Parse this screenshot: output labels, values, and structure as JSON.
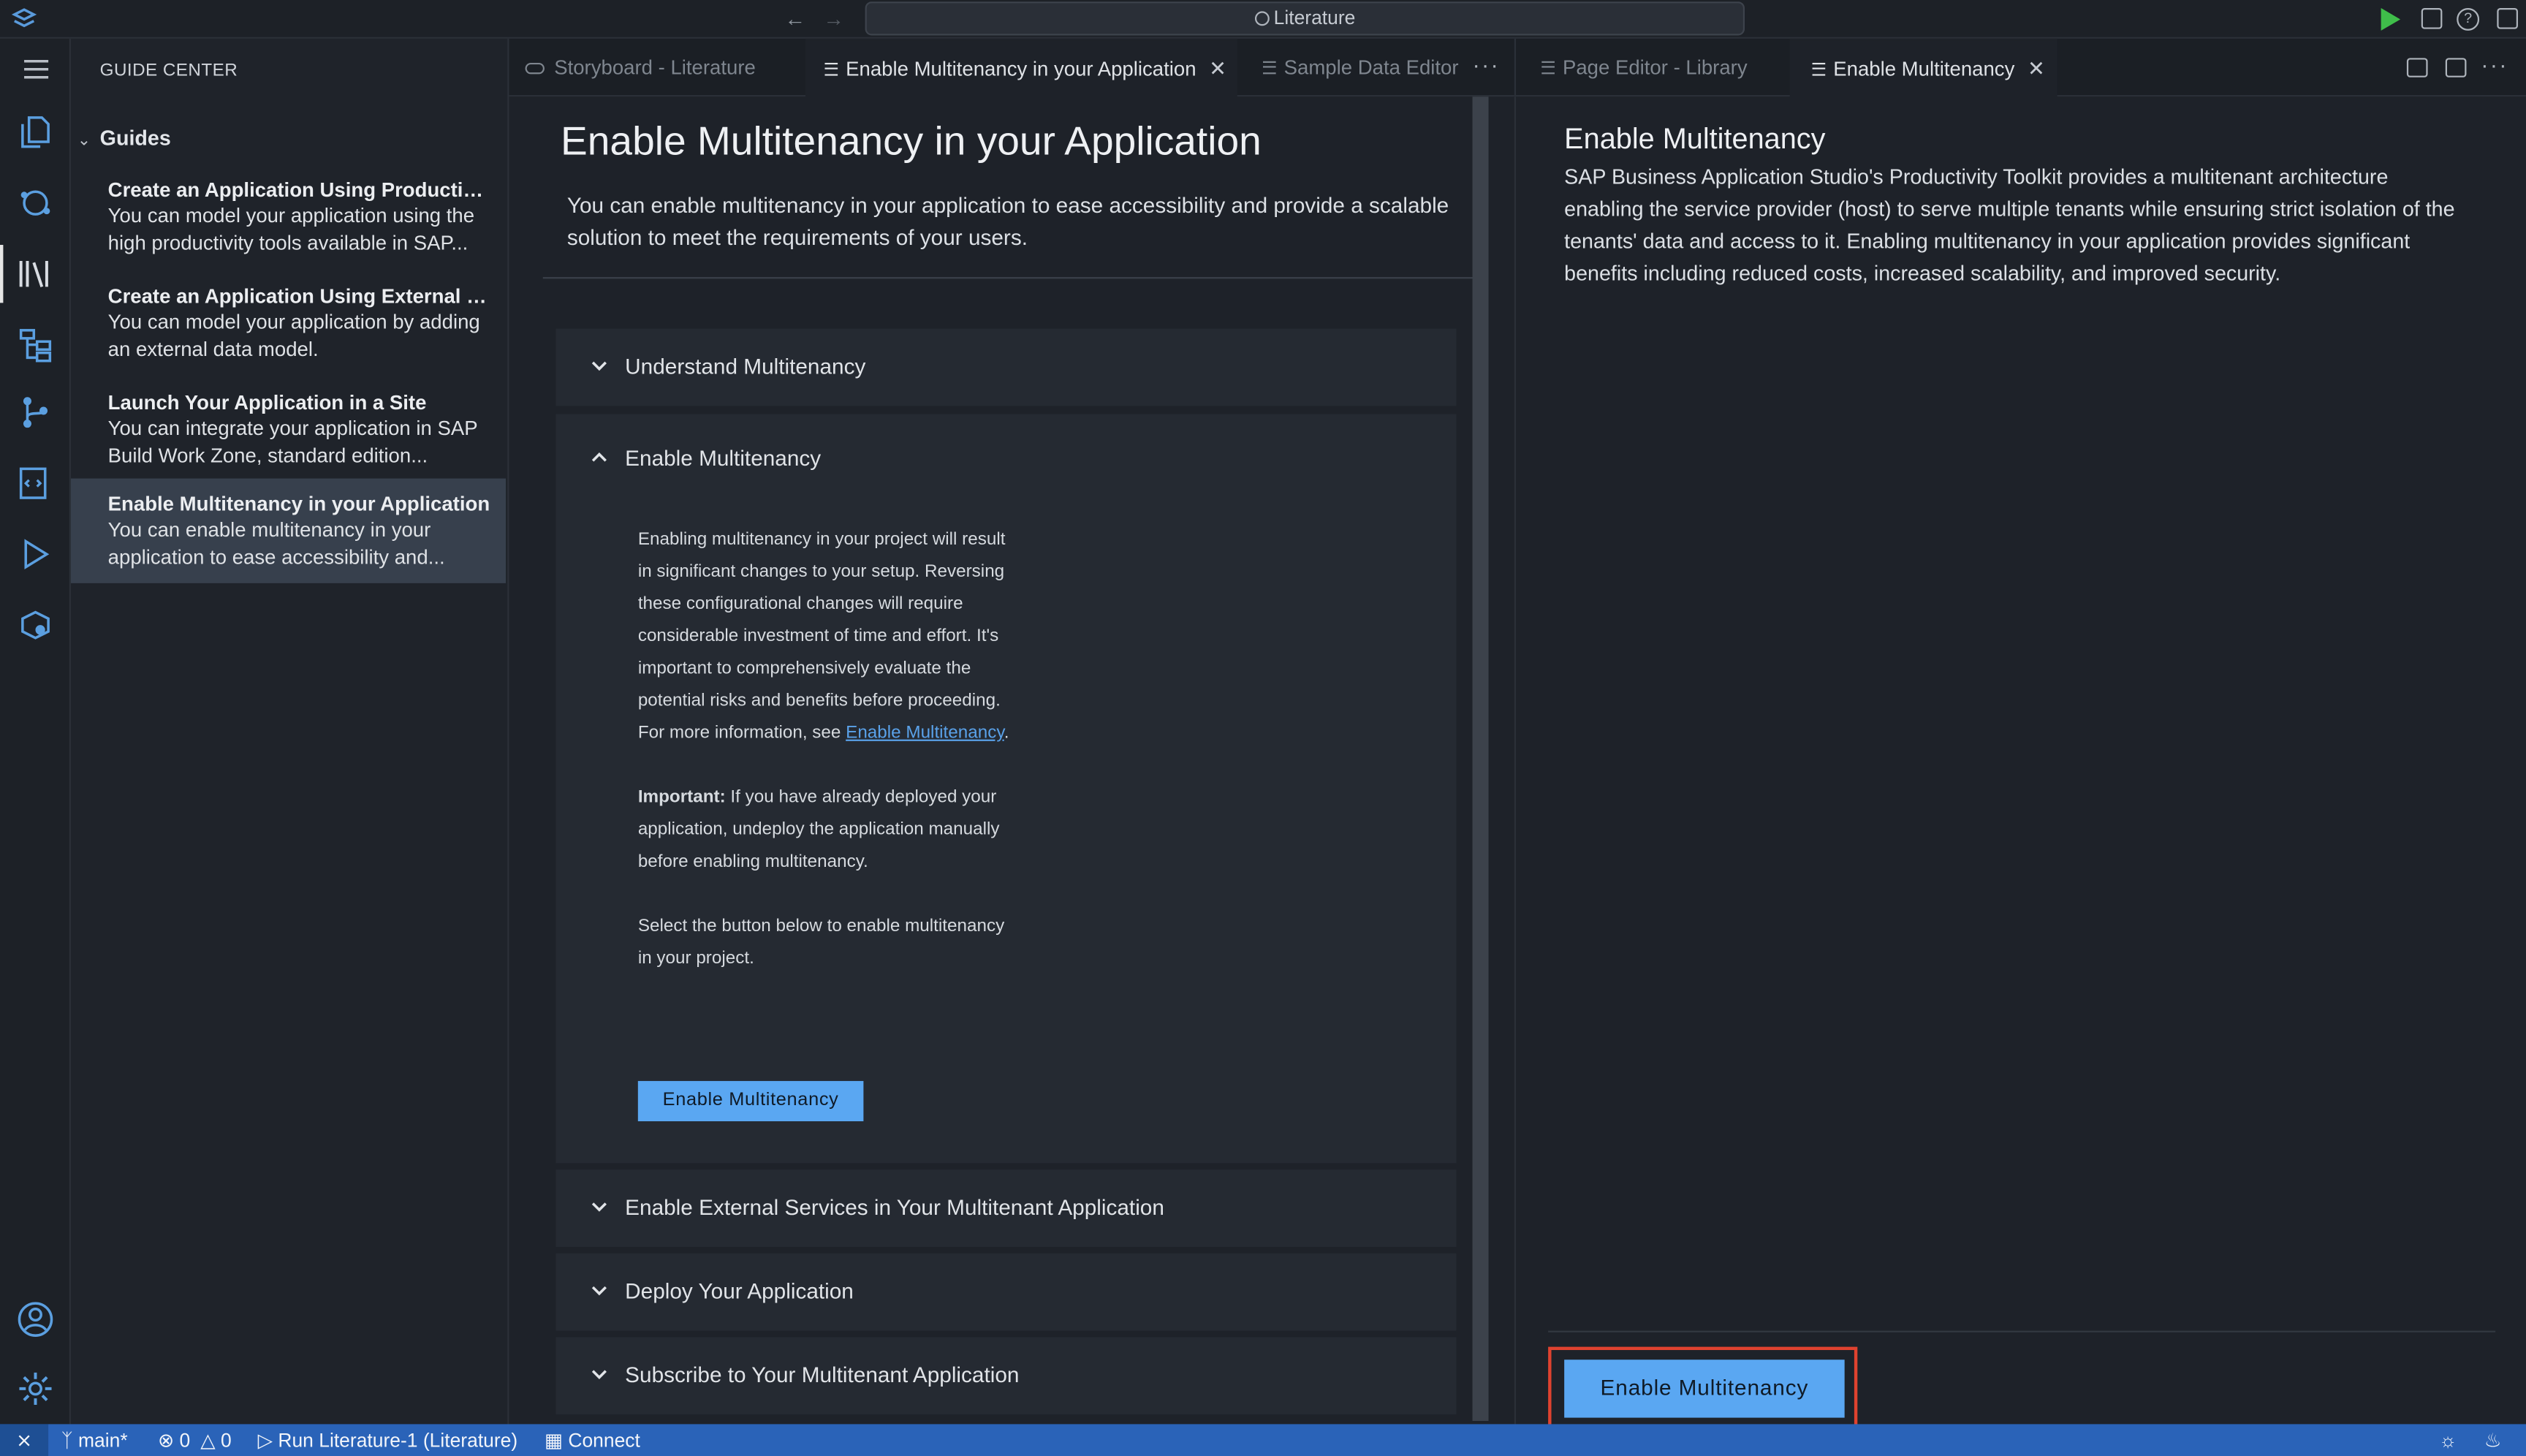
{
  "titlebar": {
    "search_text": "Literature"
  },
  "sidebar": {
    "title": "GUIDE CENTER",
    "section": "Guides",
    "guides": [
      {
        "title": "Create an Application Using Productivi...",
        "desc_line1": "You can model your application using the",
        "desc_line2": "high productivity tools available in SAP..."
      },
      {
        "title": "Create an Application Using External D...",
        "desc_line1": "You can model your application by adding",
        "desc_line2": "an external data model."
      },
      {
        "title": "Launch Your Application in a Site",
        "desc_line1": "You can integrate your application in SAP",
        "desc_line2": "Build Work Zone, standard edition..."
      },
      {
        "title": "Enable Multitenancy in your Application",
        "desc_line1": "You can enable multitenancy in your",
        "desc_line2": "application to ease accessibility and..."
      }
    ]
  },
  "editor1": {
    "tabs": [
      {
        "label": "Storyboard - Literature"
      },
      {
        "label": "Enable Multitenancy in your Application"
      },
      {
        "label": "Sample Data Editor"
      }
    ],
    "more": "···",
    "heading": "Enable Multitenancy in your Application",
    "lead": "You can enable multitenancy in your application to ease accessibility and provide a scalable solution to meet the requirements of your users.",
    "sections": [
      {
        "title": "Understand Multitenancy"
      },
      {
        "title": "Enable Multitenancy"
      },
      {
        "title": "Enable External Services in Your Multitenant Application"
      },
      {
        "title": "Deploy Your Application"
      },
      {
        "title": "Subscribe to Your Multitenant Application"
      }
    ],
    "body": {
      "p1": "Enabling multitenancy in your project will result in significant changes to your setup. Reversing these configurational changes will require considerable investment of time and effort. It's important to comprehensively evaluate the potential risks and benefits before proceeding. For more information, see ",
      "p1_link": "Enable Multitenancy",
      "p1_end": ".",
      "important_label": "Important:",
      "p2": " If you have already deployed your application, undeploy the application manually before enabling multitenancy.",
      "p3": "Select the button below to enable multitenancy in your project.",
      "button": "Enable Multitenancy"
    }
  },
  "editor2": {
    "tabs": [
      {
        "label": "Page Editor - Library"
      },
      {
        "label": "Enable Multitenancy"
      }
    ],
    "more": "···",
    "heading": "Enable Multitenancy",
    "text": "SAP Business Application Studio's Productivity Toolkit provides a multitenant architecture enabling the service provider (host) to serve multiple tenants while ensuring strict isolation of the tenants' data and access to it. Enabling multitenancy in your application provides significant benefits including reduced costs, increased scalability, and improved security.",
    "button": "Enable Multitenancy"
  },
  "statusbar": {
    "branch": "main*",
    "errors": "0",
    "warnings": "0",
    "run": "Run Literature-1 (Literature)",
    "connect": "Connect"
  },
  "colors": {
    "accent": "#5aa7f2",
    "statusbar": "#2a63b8",
    "highlight_frame": "#e0422f",
    "run": "#3fbe4a"
  }
}
